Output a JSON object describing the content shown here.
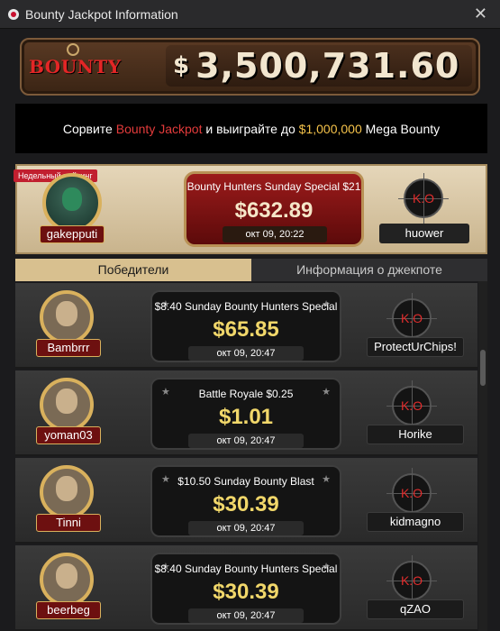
{
  "window": {
    "title": "Bounty Jackpot Information",
    "close_glyph": "✕"
  },
  "banner": {
    "logo_text": "BOUNTY",
    "currency": "$",
    "amount": "3,500,731.60"
  },
  "promo": {
    "part1": "Сорвите ",
    "highlight1": "Bounty Jackpot",
    "part2": " и выиграйте до ",
    "highlight2": "$1,000,000",
    "part3": " Mega Bounty"
  },
  "jackpot": {
    "badge": "Недельный рейтинг",
    "player": "gakepputi",
    "event": "Bounty Hunters Sunday Special $21",
    "amount": "$632.89",
    "date": "окт 09, 20:22",
    "ko_label": "K.O",
    "knocker": "huower"
  },
  "tabs": [
    {
      "label": "Победители",
      "active": true
    },
    {
      "label": "Информация о джекпоте",
      "active": false
    }
  ],
  "winners": [
    {
      "player": "Bambrrr",
      "event": "$8.40 Sunday Bounty Hunters Special",
      "prize": "$65.85",
      "date": "окт 09, 20:47",
      "ko_label": "K.O",
      "knocker": "ProtectUrChips!",
      "stars": true
    },
    {
      "player": "yoman03",
      "event": "Battle Royale $0.25",
      "prize": "$1.01",
      "date": "окт 09, 20:47",
      "ko_label": "K.O",
      "knocker": "Horike",
      "stars": true
    },
    {
      "player": "Tinni",
      "event": "$10.50 Sunday Bounty Blast",
      "prize": "$30.39",
      "date": "окт 09, 20:47",
      "ko_label": "K.O",
      "knocker": "kidmagno",
      "stars": true
    },
    {
      "player": "beerbeg",
      "event": "$8.40 Sunday Bounty Hunters Special",
      "prize": "$30.39",
      "date": "окт 09, 20:47",
      "ko_label": "K.O",
      "knocker": "qZAO",
      "stars": true
    }
  ],
  "icons": {
    "star": "★",
    "app": "app-logo-icon"
  },
  "colors": {
    "accent_red": "#e33b3b",
    "accent_gold": "#f4c24a",
    "prize_yellow": "#f1d76a",
    "tab_active": "#d8c08f"
  }
}
